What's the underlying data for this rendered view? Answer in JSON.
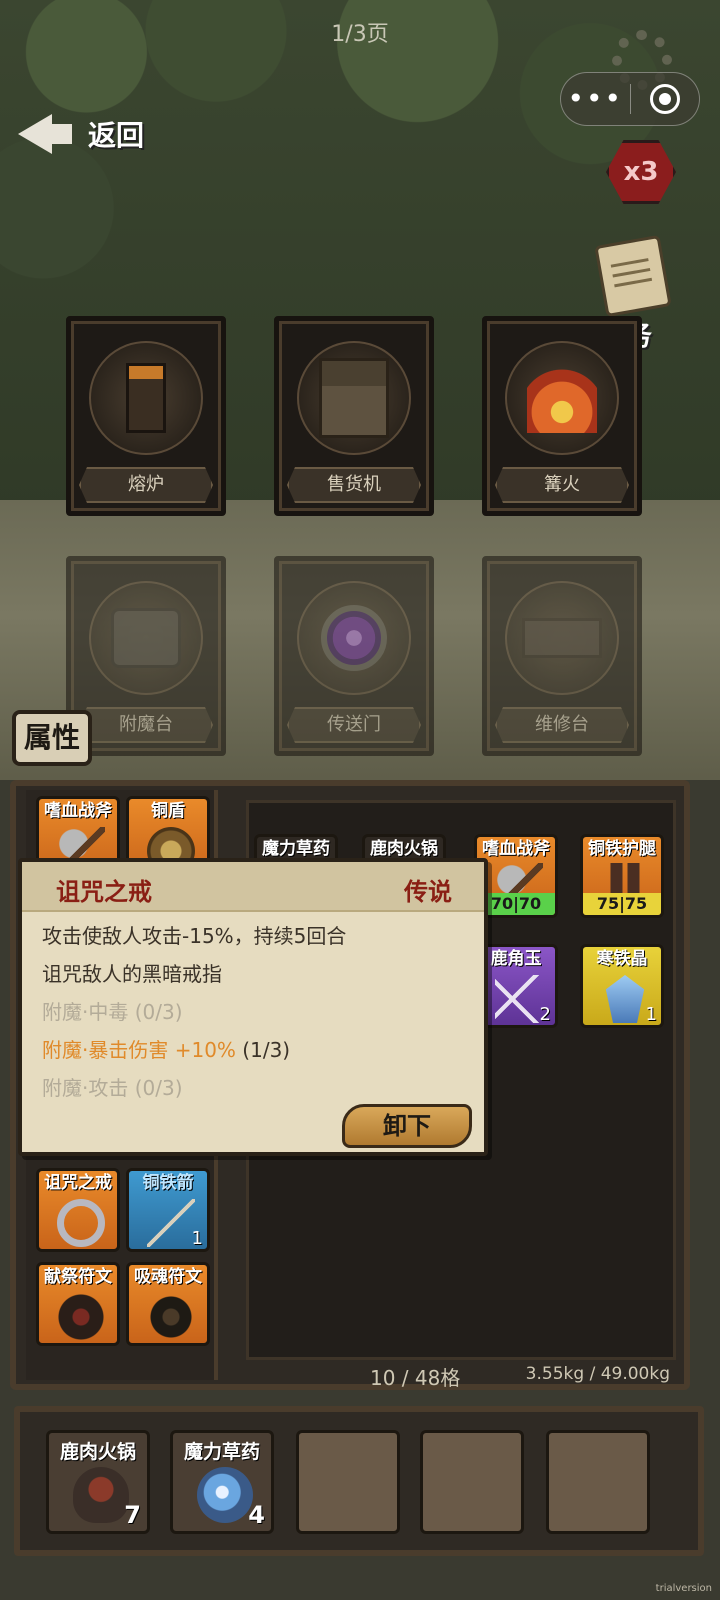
{
  "header": {
    "page_indicator": "1/3页",
    "back_label": "返回",
    "capsule_more": "•••",
    "speed_badge": "x3",
    "task_label": "任务"
  },
  "stations": [
    {
      "label": "熔炉",
      "icon": "furnace-icon",
      "state": "active"
    },
    {
      "label": "售货机",
      "icon": "vending-machine-icon",
      "state": "active"
    },
    {
      "label": "篝火",
      "icon": "campfire-icon",
      "state": "active"
    },
    {
      "label": "附魔台",
      "icon": "enchanting-table-icon",
      "state": "dimmed"
    },
    {
      "label": "传送门",
      "icon": "portal-icon",
      "state": "dimmed"
    },
    {
      "label": "维修台",
      "icon": "repair-bench-icon",
      "state": "dimmed"
    }
  ],
  "attributes_tab": "属性",
  "equipment": [
    {
      "name": "嗜血战斧",
      "color": "#e98a2a",
      "icon": "axe-icon"
    },
    {
      "name": "铜盾",
      "color": "#e98a2a",
      "icon": "shield-icon"
    },
    {
      "name": "诅咒之戒",
      "color": "#e98a2a",
      "icon": "ring-icon"
    },
    {
      "name": "铜铁箭",
      "color": "#3f9ad0",
      "icon": "arrow-icon",
      "count": "1"
    },
    {
      "name": "献祭符文",
      "color": "#e98a2a",
      "icon": "rune-icon"
    },
    {
      "name": "吸魂符文",
      "color": "#e98a2a",
      "icon": "star-rune-icon"
    }
  ],
  "bag": [
    {
      "name": "魔力草药",
      "color": "#2e2822"
    },
    {
      "name": "鹿肉火锅",
      "color": "#2e2822"
    },
    {
      "name": "嗜血战斧",
      "color": "#e98a2a",
      "icon": "axe-icon",
      "durability": "70|70"
    },
    {
      "name": "铜铁护腿",
      "color": "#e98a2a",
      "icon": "leggings-icon",
      "durability": "75|75"
    },
    {
      "name": "鹿角玉",
      "color": "#8b56c7",
      "icon": "antler-jade-icon",
      "count": "2"
    },
    {
      "name": "寒铁晶",
      "color": "#e8d23a",
      "icon": "crystal-icon",
      "count": "1"
    }
  ],
  "tooltip": {
    "title": "诅咒之戒",
    "rarity": "传说",
    "effect": "攻击使敌人攻击-15%，持续5回合",
    "description": "诅咒敌人的黑暗戒指",
    "enchants": [
      {
        "text": "附魔·中毒 (0/3)",
        "state": "inactive"
      },
      {
        "text": "附魔·暴击伤害 +10%",
        "count": "(1/3)",
        "state": "active"
      },
      {
        "text": "附魔·攻击 (0/3)",
        "state": "inactive"
      }
    ],
    "unequip_label": "卸下"
  },
  "capacity": {
    "slots": "10 / 48格",
    "weight": "3.55kg / 49.00kg"
  },
  "quickbar": [
    {
      "name": "鹿肉火锅",
      "icon": "hotpot-icon",
      "count": "7"
    },
    {
      "name": "魔力草药",
      "icon": "potion-icon",
      "count": "4"
    },
    {
      "name": "",
      "icon": "",
      "count": ""
    },
    {
      "name": "",
      "icon": "",
      "count": ""
    },
    {
      "name": "",
      "icon": "",
      "count": ""
    }
  ],
  "trial_tag": "trialversion"
}
